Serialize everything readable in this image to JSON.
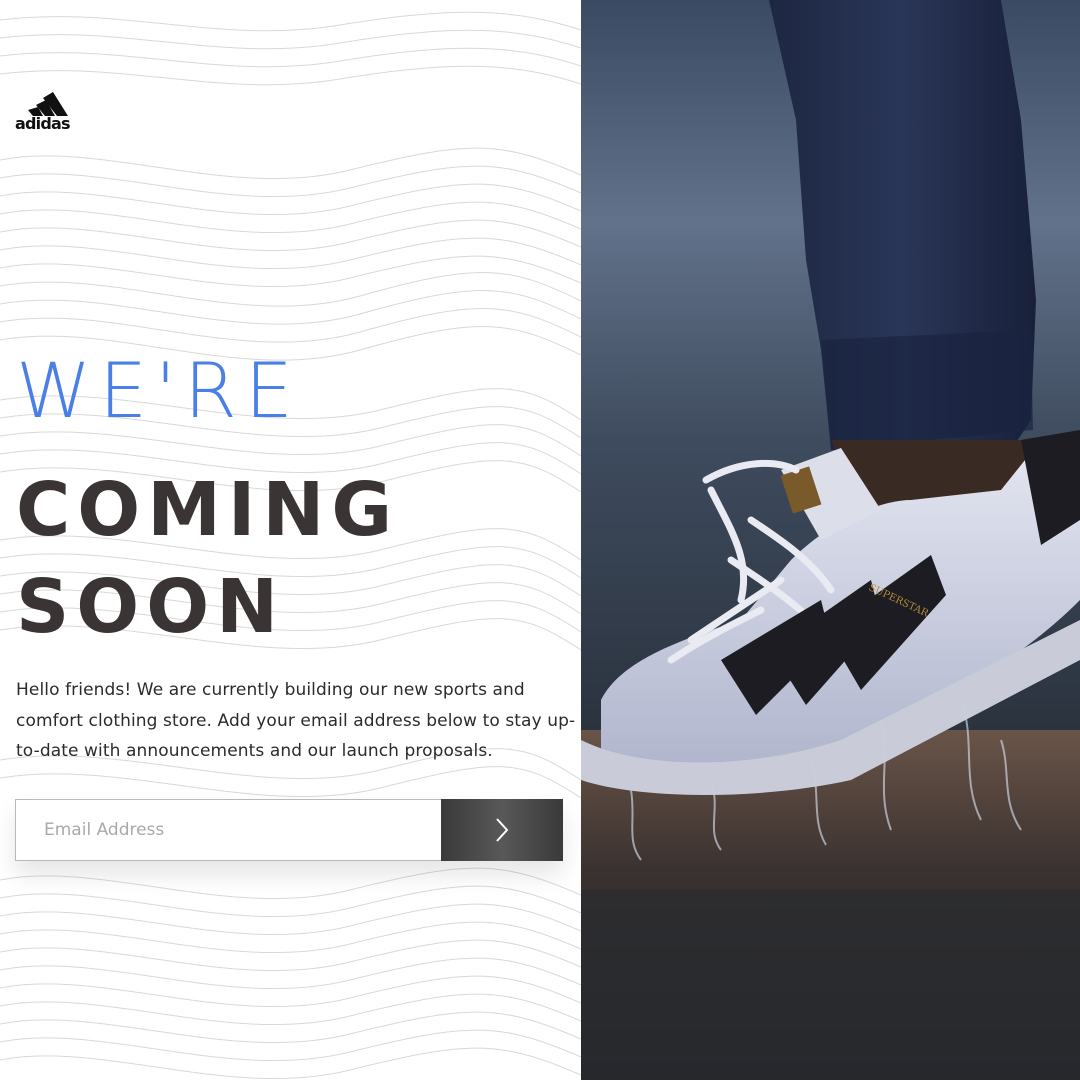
{
  "brand": {
    "logo_text": "adidas"
  },
  "hero": {
    "line1": "WE'RE",
    "line2": "COMING",
    "line3": "SOON"
  },
  "description": "Hello friends! We are currently building our new sports and comfort clothing store. Add your email address below to stay up-to-date with announcements and our launch proposals.",
  "signup": {
    "email_placeholder": "Email Address",
    "email_value": "",
    "submit_icon": "chevron-right-icon"
  },
  "photo": {
    "shoe_label": "SUPERSTAR"
  },
  "colors": {
    "accent": "#4a7fe6",
    "heading": "#3a3434",
    "button": "#444444"
  }
}
